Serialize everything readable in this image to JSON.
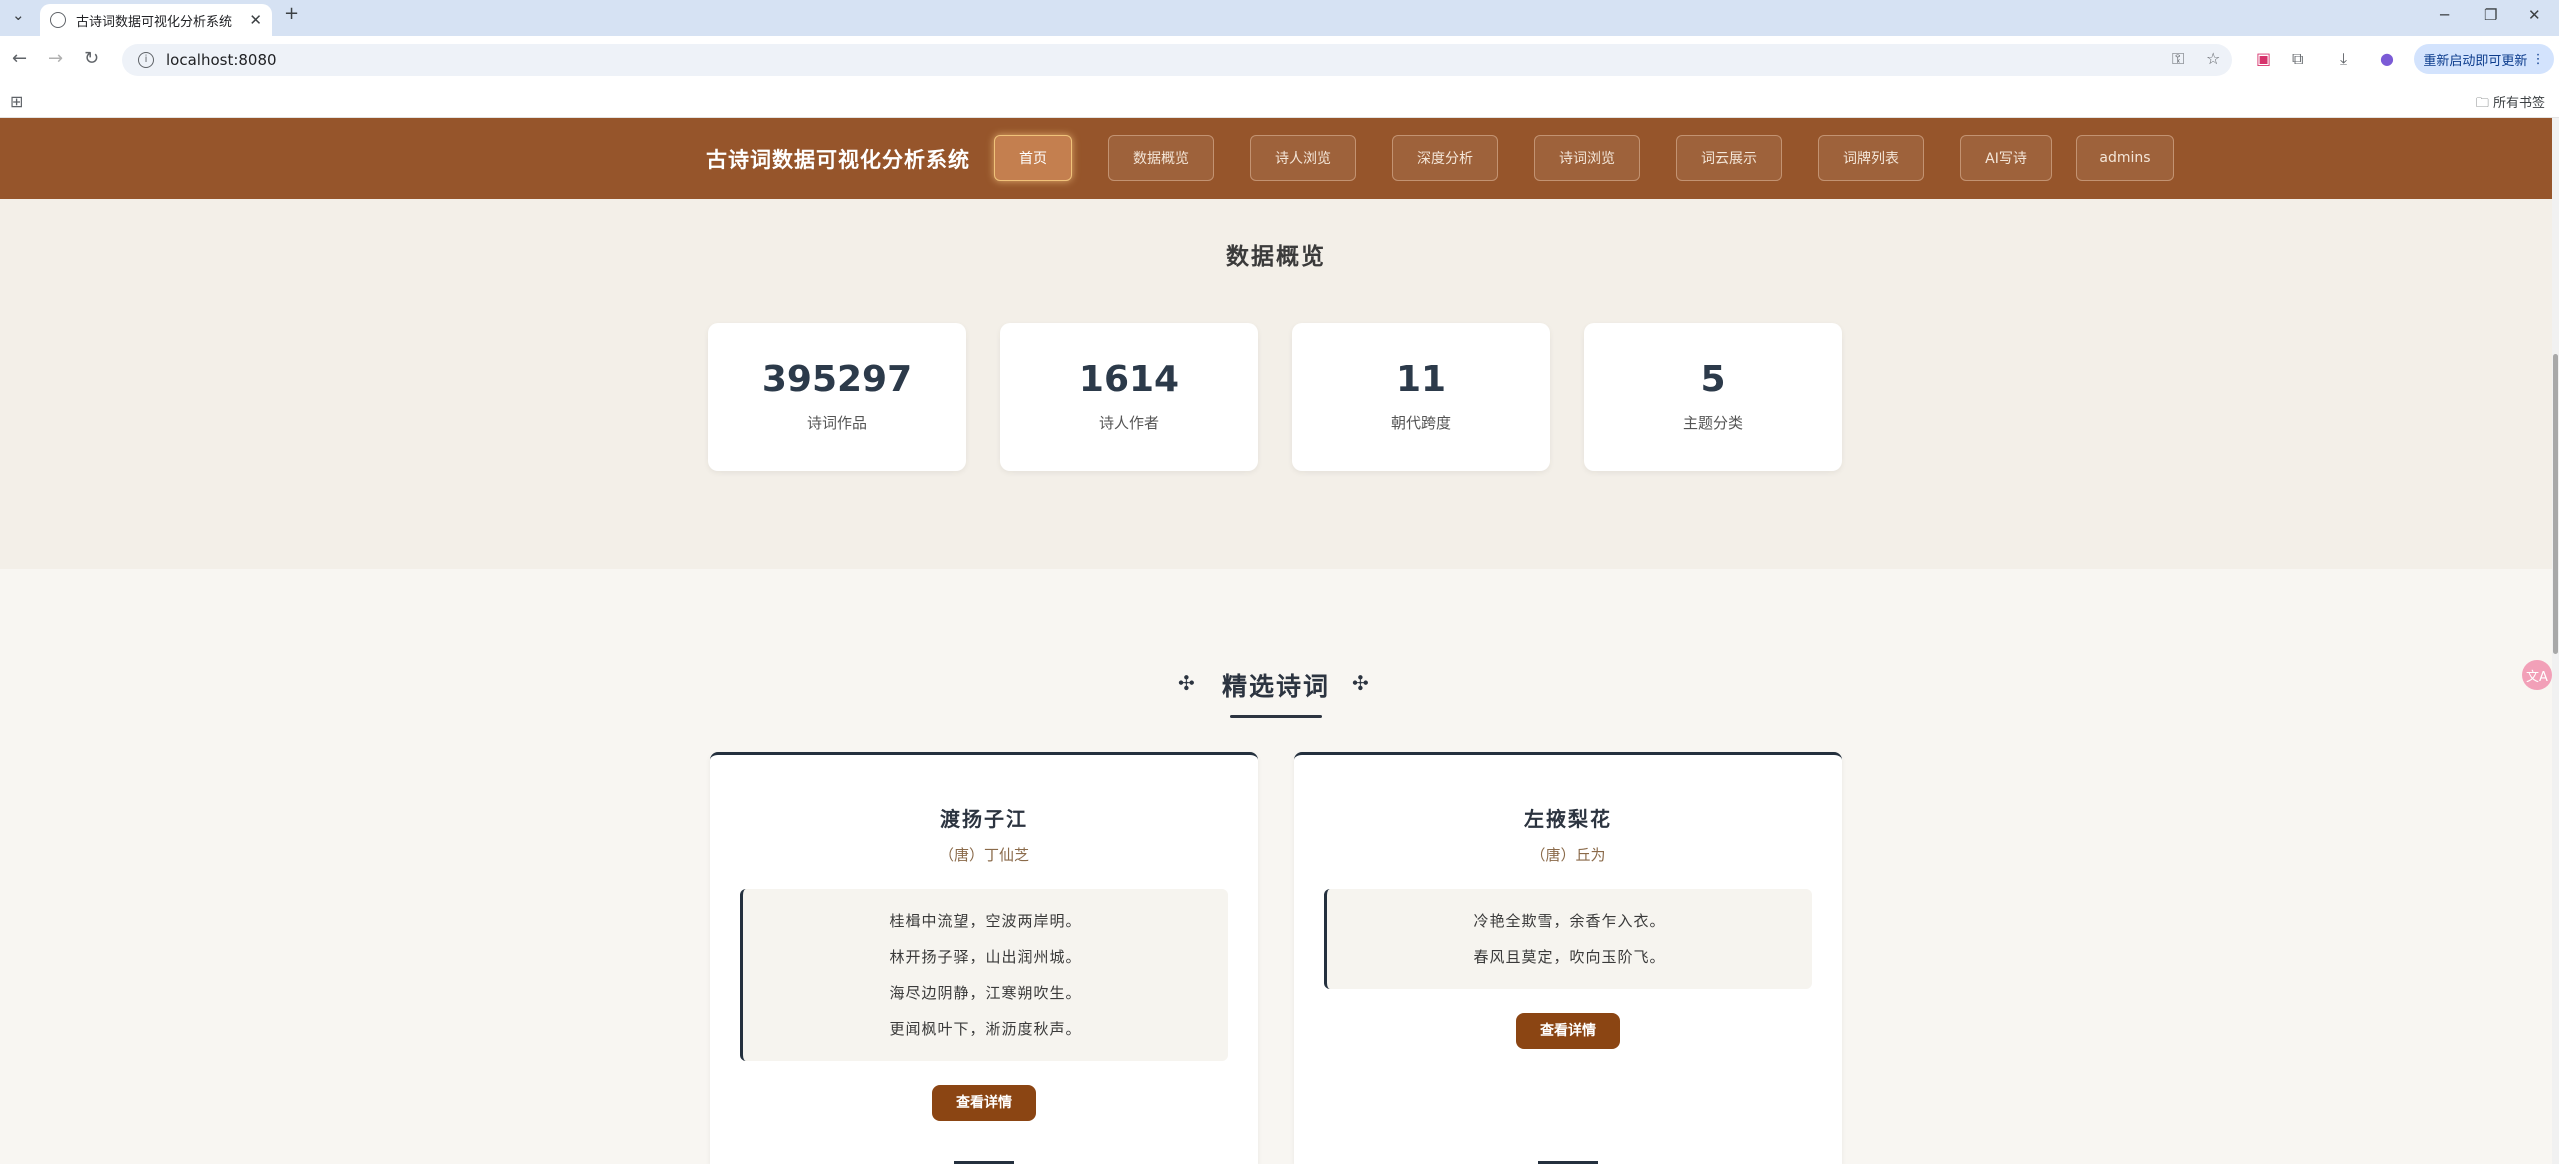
{
  "browser": {
    "tab_title": "古诗词数据可视化分析系统",
    "url": "localhost:8080",
    "update_button": "重新启动即可更新",
    "all_bookmarks": "所有书签"
  },
  "navbar": {
    "site_title": "古诗词数据可视化分析系统",
    "items": [
      {
        "label": "首页",
        "active": true
      },
      {
        "label": "数据概览"
      },
      {
        "label": "诗人浏览"
      },
      {
        "label": "深度分析"
      },
      {
        "label": "诗词浏览"
      },
      {
        "label": "词云展示"
      },
      {
        "label": "词牌列表"
      },
      {
        "label": "AI写诗"
      },
      {
        "label": "admins"
      }
    ]
  },
  "overview": {
    "title": "数据概览",
    "stats": [
      {
        "value": "395297",
        "label": "诗词作品"
      },
      {
        "value": "1614",
        "label": "诗人作者"
      },
      {
        "value": "11",
        "label": "朝代跨度"
      },
      {
        "value": "5",
        "label": "主题分类"
      }
    ]
  },
  "featured": {
    "title": "精选诗词",
    "ornament": "✣",
    "cards": [
      {
        "title": "渡扬子江",
        "author": "（唐）丁仙芝",
        "verses": [
          "桂楫中流望，空波两岸明。",
          "林开扬子驿，山出润州城。",
          "海尽边阴静，江寒朔吹生。",
          "更闻枫叶下，淅沥度秋声。"
        ],
        "button": "查看详情"
      },
      {
        "title": "左掖梨花",
        "author": "（唐）丘为",
        "verses": [
          "冷艳全欺雪，余香乍入衣。",
          "春风且莫定，吹向玉阶飞。"
        ],
        "button": "查看详情"
      }
    ]
  }
}
